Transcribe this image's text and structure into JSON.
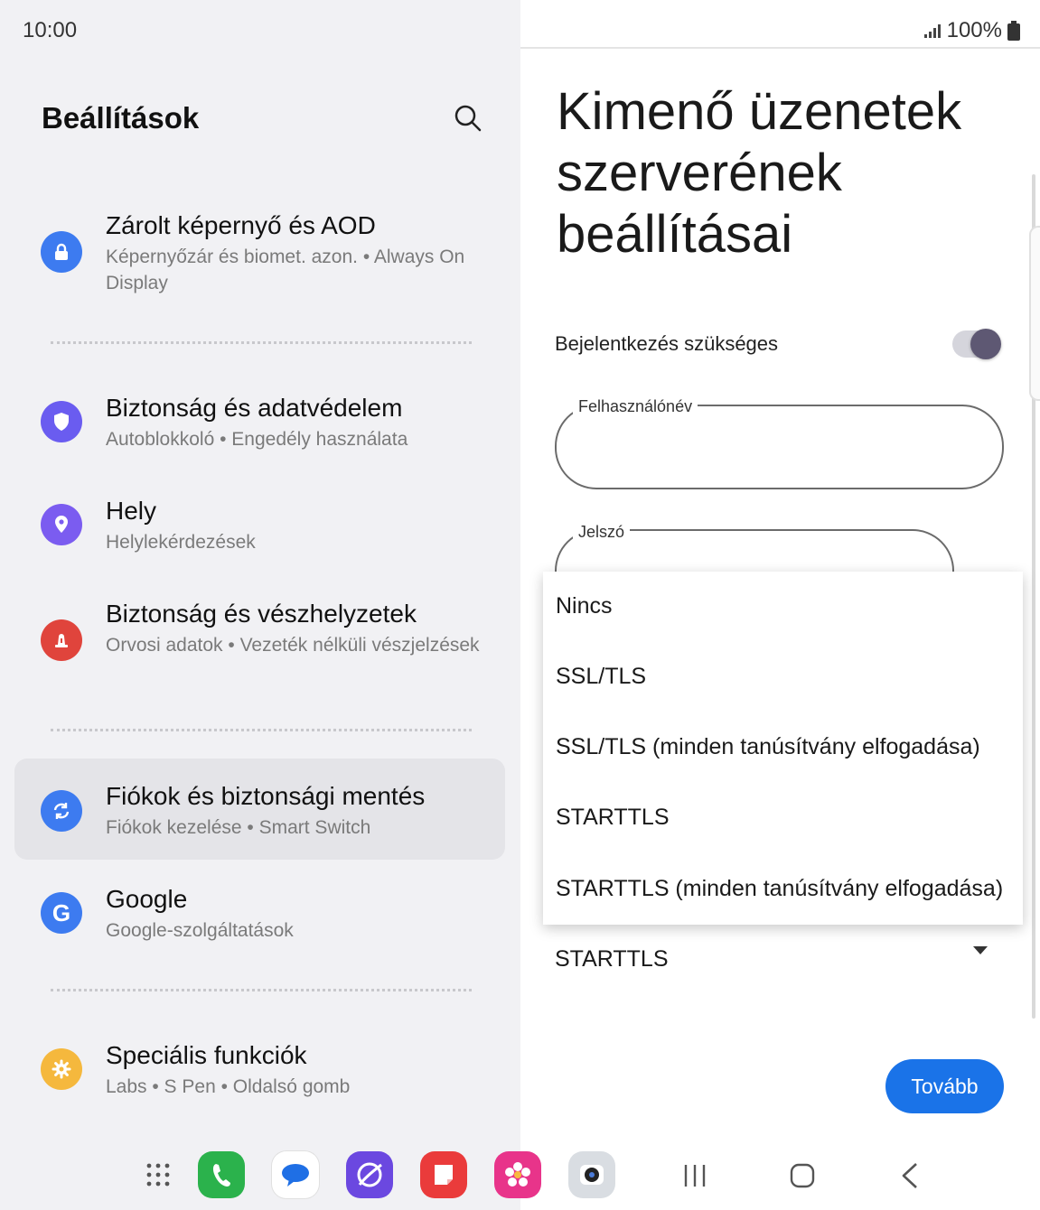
{
  "status_bar": {
    "time": "10:00",
    "battery": "100%",
    "signal_icon": "signal-icon",
    "battery_icon": "battery-icon"
  },
  "left_panel": {
    "title": "Beállítások",
    "items": [
      {
        "title": "Zárolt képernyő és AOD",
        "subtitle": "Képernyőzár és biomet. azon.  •  Always On Display",
        "icon": "lock-icon",
        "color": "#3d7bf0"
      },
      {
        "title": "Biztonság és adatvédelem",
        "subtitle": "Autoblokkoló  •  Engedély használata",
        "icon": "shield-icon",
        "color": "#6a5cf0"
      },
      {
        "title": "Hely",
        "subtitle": "Helylekérdezések",
        "icon": "location-pin-icon",
        "color": "#7b5cf0"
      },
      {
        "title": "Biztonság és vészhelyzetek",
        "subtitle": "Orvosi adatok  •  Vezeték nélküli vészjelzések",
        "icon": "alert-icon",
        "color": "#e0443c"
      },
      {
        "title": "Fiókok és biztonsági mentés",
        "subtitle": "Fiókok kezelése  •  Smart Switch",
        "icon": "sync-icon",
        "color": "#3d7bf0"
      },
      {
        "title": "Google",
        "subtitle": "Google-szolgáltatások",
        "icon": "google-icon",
        "color": "#3d7bf0"
      },
      {
        "title": "Speciális funkciók",
        "subtitle": "Labs  •  S Pen  •  Oldalsó gomb",
        "icon": "gear-icon",
        "color": "#f5b83d"
      }
    ]
  },
  "right_panel": {
    "title": "Kimenő üzenetek szerverének beállításai",
    "login_required_label": "Bejelentkezés szükséges",
    "login_required": true,
    "username_label": "Felhasználónév",
    "username_value": "",
    "password_label": "Jelszó",
    "security_dropdown": {
      "options": [
        "Nincs",
        "SSL/TLS",
        "SSL/TLS (minden tanúsítvány elfogadása)",
        "STARTTLS",
        "STARTTLS (minden tanúsítvány elfogadása)"
      ],
      "selected": "STARTTLS"
    },
    "next_button": "Tovább",
    "accent": "#1a73e8"
  },
  "nav_bar": {
    "apps": [
      "apps-grid-icon",
      "phone-icon",
      "messages-icon",
      "internet-icon",
      "notes-icon",
      "gallery-icon",
      "camera-icon"
    ],
    "buttons": [
      "recents-icon",
      "home-icon",
      "back-icon"
    ]
  }
}
